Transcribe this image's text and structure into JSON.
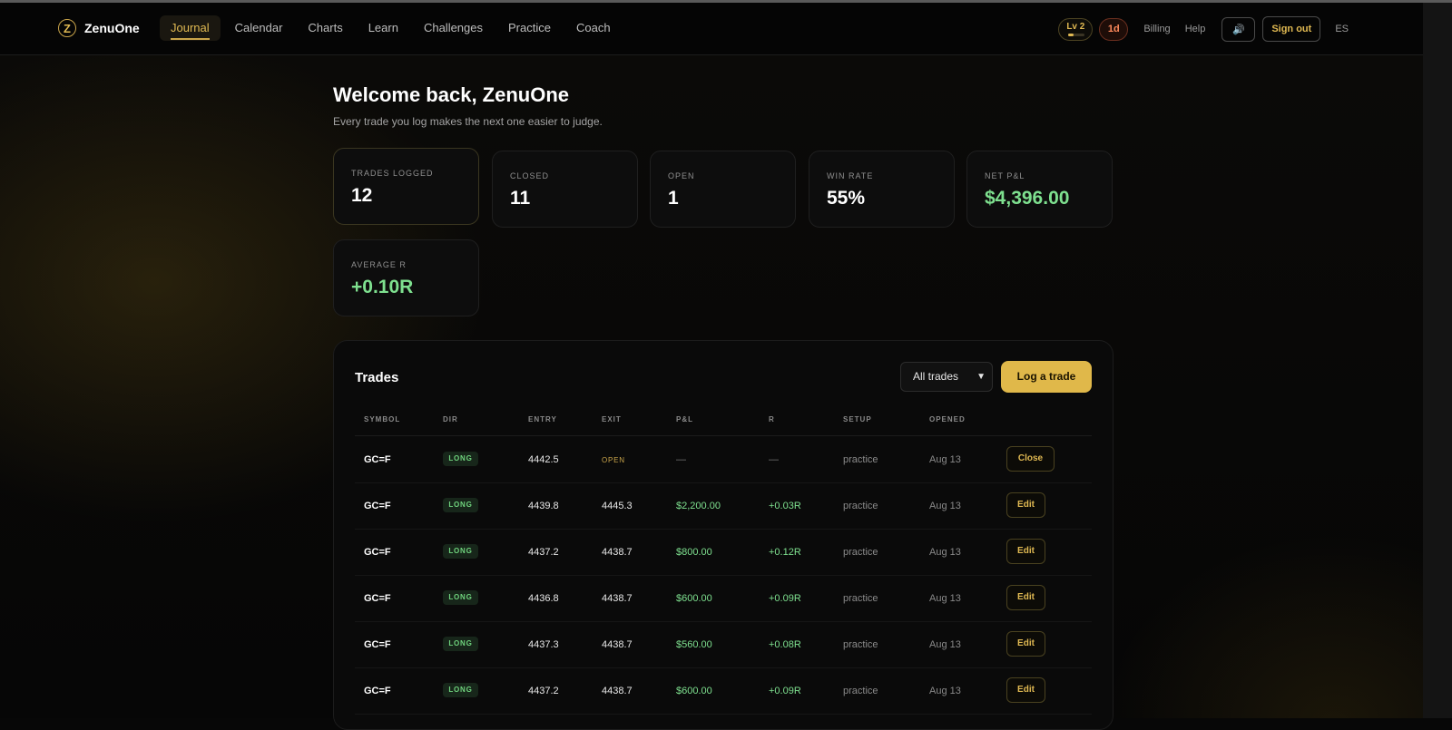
{
  "app": {
    "name": "ZenuOne",
    "logo_letter": "Z"
  },
  "nav": {
    "items": [
      {
        "label": "Journal",
        "active": true
      },
      {
        "label": "Calendar"
      },
      {
        "label": "Charts"
      },
      {
        "label": "Learn"
      },
      {
        "label": "Challenges"
      },
      {
        "label": "Practice"
      },
      {
        "label": "Coach"
      }
    ]
  },
  "header": {
    "level": "Lv 2",
    "level_progress": 0.3,
    "streak": "1d",
    "billing": "Billing",
    "help": "Help",
    "sound_icon": "speaker-icon",
    "sound_glyph": "🔊",
    "signout": "Sign out",
    "lang": "ES"
  },
  "welcome": {
    "title": "Welcome back, ZenuOne",
    "subtitle": "Every trade you log makes the next one easier to judge."
  },
  "stats": [
    {
      "label": "TRADES LOGGED",
      "value": "12"
    },
    {
      "label": "CLOSED",
      "value": "11"
    },
    {
      "label": "OPEN",
      "value": "1"
    },
    {
      "label": "WIN RATE",
      "value": "55%"
    },
    {
      "label": "NET P&L",
      "value": "$4,396.00",
      "color": "#7ee08f"
    },
    {
      "label": "AVERAGE R",
      "value": "+0.10R",
      "color": "#7ee08f"
    }
  ],
  "trades": {
    "title": "Trades",
    "filter": "All trades",
    "log_button": "Log a trade",
    "columns": [
      "SYMBOL",
      "DIR",
      "ENTRY",
      "EXIT",
      "P&L",
      "R",
      "SETUP",
      "OPENED"
    ],
    "rows": [
      {
        "symbol": "GC=F",
        "dir": "LONG",
        "entry": "4442.5",
        "exit": "OPEN",
        "pnl": "—",
        "r": "—",
        "setup": "practice",
        "opened": "Aug 13",
        "action": "Close"
      },
      {
        "symbol": "GC=F",
        "dir": "LONG",
        "entry": "4439.8",
        "exit": "4445.3",
        "pnl": "$2,200.00",
        "r": "+0.03R",
        "setup": "practice",
        "opened": "Aug 13",
        "action": "Edit"
      },
      {
        "symbol": "GC=F",
        "dir": "LONG",
        "entry": "4437.2",
        "exit": "4438.7",
        "pnl": "$800.00",
        "r": "+0.12R",
        "setup": "practice",
        "opened": "Aug 13",
        "action": "Edit"
      },
      {
        "symbol": "GC=F",
        "dir": "LONG",
        "entry": "4436.8",
        "exit": "4438.7",
        "pnl": "$600.00",
        "r": "+0.09R",
        "setup": "practice",
        "opened": "Aug 13",
        "action": "Edit"
      },
      {
        "symbol": "GC=F",
        "dir": "LONG",
        "entry": "4437.3",
        "exit": "4438.7",
        "pnl": "$560.00",
        "r": "+0.08R",
        "setup": "practice",
        "opened": "Aug 13",
        "action": "Edit"
      },
      {
        "symbol": "GC=F",
        "dir": "LONG",
        "entry": "4437.2",
        "exit": "4438.7",
        "pnl": "$600.00",
        "r": "+0.09R",
        "setup": "practice",
        "opened": "Aug 13",
        "action": "Edit"
      }
    ]
  },
  "colors": {
    "accent": "#e0b84a",
    "positive": "#7ee08f",
    "background": "#070707"
  }
}
